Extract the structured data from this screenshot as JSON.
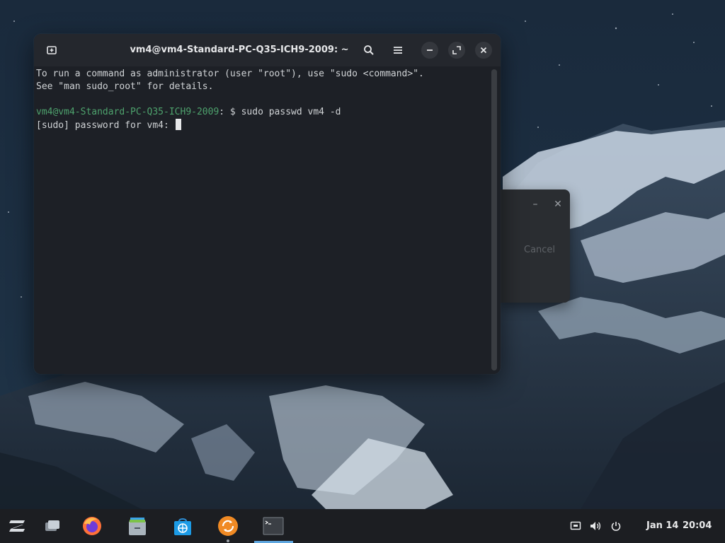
{
  "terminal": {
    "title": "vm4@vm4-Standard-PC-Q35-ICH9-2009: ~",
    "lines": [
      "To run a command as administrator (user \"root\"), use \"sudo <command>\".",
      "See \"man sudo_root\" for details.",
      ""
    ],
    "prompt_user": "vm4@vm4-Standard-PC-Q35-ICH9-2009",
    "prompt_suffix": ": $ ",
    "command": "sudo passwd vm4 -d",
    "password_prompt": "[sudo] password for vm4: "
  },
  "dialog": {
    "cancel_label": "Cancel",
    "minimize_glyph": "–",
    "close_glyph": "✕"
  },
  "taskbar": {
    "apps": [
      "zorin-menu-icon",
      "workspaces-icon",
      "firefox-icon",
      "files-icon",
      "software-store-icon",
      "software-updater-icon",
      "terminal-icon"
    ],
    "active_app": "terminal",
    "date": "Jan 14",
    "time": "20:04"
  },
  "colors": {
    "terminal_bg": "#1d2026",
    "prompt_green": "#4ea26d",
    "accent_blue": "#5ea7e0",
    "firefox_orange": "#ff7139",
    "updater_orange": "#f08a24"
  }
}
